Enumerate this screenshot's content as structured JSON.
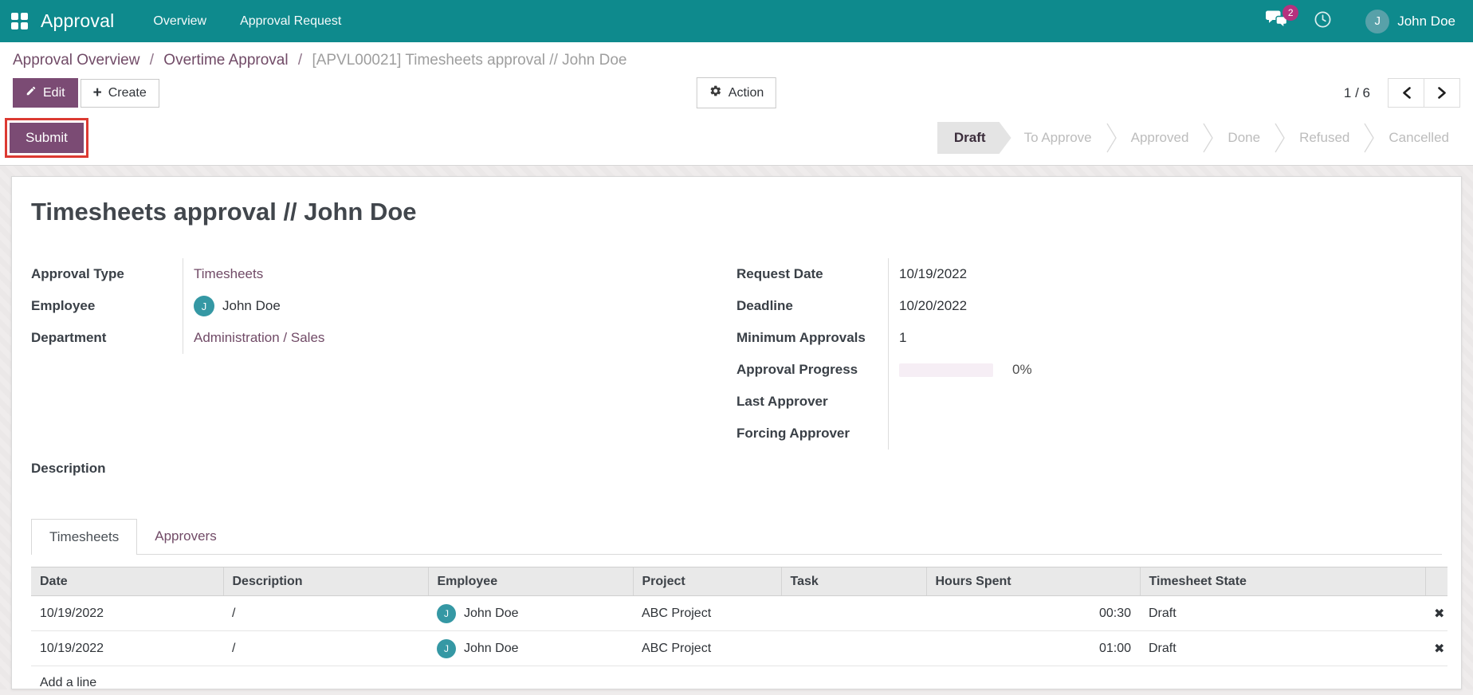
{
  "colors": {
    "navbar_bg": "#0e8a8d",
    "primary_purple": "#7b4b74",
    "link_purple": "#714B67",
    "badge_pink": "#b5317e",
    "avatar_teal": "#3598a4",
    "highlight_red": "#dc3a32",
    "progress_track": "#f6eef5"
  },
  "navbar": {
    "app_name": "Approval",
    "menu": [
      {
        "label": "Overview"
      },
      {
        "label": "Approval Request"
      }
    ],
    "messages_badge": "2",
    "user_initial": "J",
    "user_name": "John Doe"
  },
  "breadcrumb": {
    "separator": "/",
    "items": [
      "Approval Overview",
      "Overtime Approval"
    ],
    "current": "[APVL00021] Timesheets approval // John Doe"
  },
  "control_panel": {
    "edit_label": "Edit",
    "create_label": "Create",
    "action_label": "Action",
    "pager_count": "1 / 6"
  },
  "statusbar": {
    "submit_label": "Submit",
    "steps": [
      {
        "label": "Draft",
        "active": true
      },
      {
        "label": "To Approve",
        "active": false
      },
      {
        "label": "Approved",
        "active": false
      },
      {
        "label": "Done",
        "active": false
      },
      {
        "label": "Refused",
        "active": false
      },
      {
        "label": "Cancelled",
        "active": false
      }
    ]
  },
  "form": {
    "title": "Timesheets approval // John Doe",
    "fields_left": [
      {
        "label": "Approval Type",
        "value": "Timesheets"
      },
      {
        "label": "Employee",
        "value": "John Doe",
        "initial": "J"
      },
      {
        "label": "Department",
        "value": "Administration / Sales"
      }
    ],
    "fields_right": [
      {
        "label": "Request Date",
        "value": "10/19/2022"
      },
      {
        "label": "Deadline",
        "value": "10/20/2022"
      },
      {
        "label": "Minimum Approvals",
        "value": "1"
      },
      {
        "label": "Approval Progress",
        "value": "0%",
        "progress_percent": 0
      },
      {
        "label": "Last Approver",
        "value": ""
      },
      {
        "label": "Forcing Approver",
        "value": ""
      }
    ],
    "description_label": "Description",
    "tabs": [
      {
        "label": "Timesheets",
        "active": true
      },
      {
        "label": "Approvers",
        "active": false
      }
    ]
  },
  "table": {
    "columns": [
      "Date",
      "Description",
      "Employee",
      "Project",
      "Task",
      "Hours Spent",
      "Timesheet State",
      ""
    ],
    "delete_icon": "✖",
    "rows": [
      {
        "date": "10/19/2022",
        "description": "/",
        "employee": "John Doe",
        "employee_initial": "J",
        "project": "ABC Project",
        "task": "",
        "hours": "00:30",
        "state": "Draft"
      },
      {
        "date": "10/19/2022",
        "description": "/",
        "employee": "John Doe",
        "employee_initial": "J",
        "project": "ABC Project",
        "task": "",
        "hours": "01:00",
        "state": "Draft"
      }
    ],
    "add_line_label": "Add a line"
  }
}
